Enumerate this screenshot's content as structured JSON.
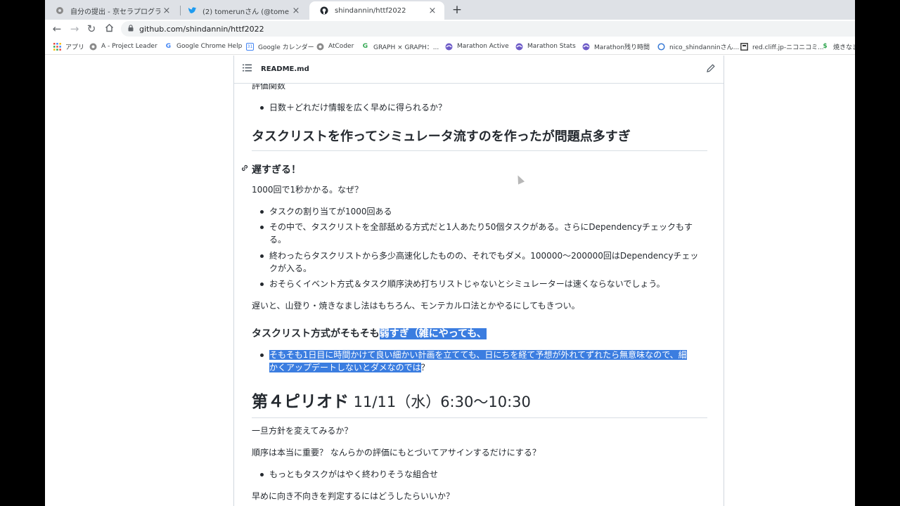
{
  "tabs": [
    {
      "title": "自分の提出 - 京セラプログラミングコ",
      "active": false
    },
    {
      "title": "(2) tomerunさん (@tomerun) / Tw",
      "active": false
    },
    {
      "title": "shindannin/httf2022",
      "active": true
    }
  ],
  "address": {
    "url": "github.com/shindannin/httf2022"
  },
  "bookmarks": [
    {
      "label": "アプリ",
      "icon": "apps-grid-icon"
    },
    {
      "label": "A - Project Leader",
      "icon": "atcoder-icon"
    },
    {
      "label": "Google Chrome Help",
      "icon": "google-icon"
    },
    {
      "label": "Google カレンダー",
      "icon": "calendar-icon"
    },
    {
      "label": "AtCoder",
      "icon": "atcoder-icon"
    },
    {
      "label": "GRAPH × GRAPH：...",
      "icon": "graph-icon"
    },
    {
      "label": "Marathon Active",
      "icon": "marathon-icon"
    },
    {
      "label": "Marathon Stats",
      "icon": "marathon-icon"
    },
    {
      "label": "Marathon残り時間",
      "icon": "marathon-icon"
    },
    {
      "label": "nico_shindanninさん...",
      "icon": "nico-icon"
    },
    {
      "label": "red.cliff.jp-ニコニコミ...",
      "icon": "page-icon"
    },
    {
      "label": "焼きなま",
      "icon": "dollar-icon"
    }
  ],
  "readme": {
    "filename": "README.md",
    "blocks": {
      "cut_para": "評価関数",
      "li_eval": "日数＋どれだけ情報を広く早めに得られるか？",
      "h2_tasklist": "タスクリストを作ってシミュレータ流すのを作ったが問題点多すぎ",
      "h3_slow": "遅すぎる！",
      "p_1000": "1000回で1秒かかる。なぜ？",
      "li_1": "タスクの割り当てが1000回ある",
      "li_2a": "その中で、タスクリストを全部舐める方式だと1人あたり50個タスクがある。さらにDependencyチェックもす",
      "li_2b": "る。",
      "li_3a": "終わったらタスクリストから多少高速化したものの、それでもダメ。100000～200000回はDependencyチェッ",
      "li_3b": "クが入る。",
      "li_4": "おそらくイベント方式＆タスク順序決め打ちリストじゃないとシミュレーターは速くならないでしょう。",
      "p_late": "遅いと、山登り・焼きなまし法はもちろん、モンテカルロ法とかやるにしてもきつい。",
      "h3_method_a": "タスクリスト方式がそもそも",
      "h3_method_b": "弱すぎ（雑にやっても、",
      "li_sel_a": "そもそも1日目に時間かけて良い細かい計画を立てても、日にちを経て予想が外れてずれたら無意味なので、細",
      "li_sel_b": "かくアップデートしないとダメなのでは",
      "li_sel_c": "？",
      "h1_period_a": "第４ピリオド",
      "h1_period_b": " 11/11（水）6:30～10:30",
      "p_policy": "一旦方針を変えてみるか？",
      "p_order": "順序は本当に重要？ なんらかの評価にもとづいてアサインするだけにする？",
      "li_combo": "もっともタスクがはやく終わりそうな組合せ",
      "p_judge": "早めに向き不向きを判定するにはどうしたらいいか？"
    }
  },
  "colors": {
    "selection": "#3b7de0",
    "text": "#24292f",
    "tabstrip": "#dee1e6"
  }
}
